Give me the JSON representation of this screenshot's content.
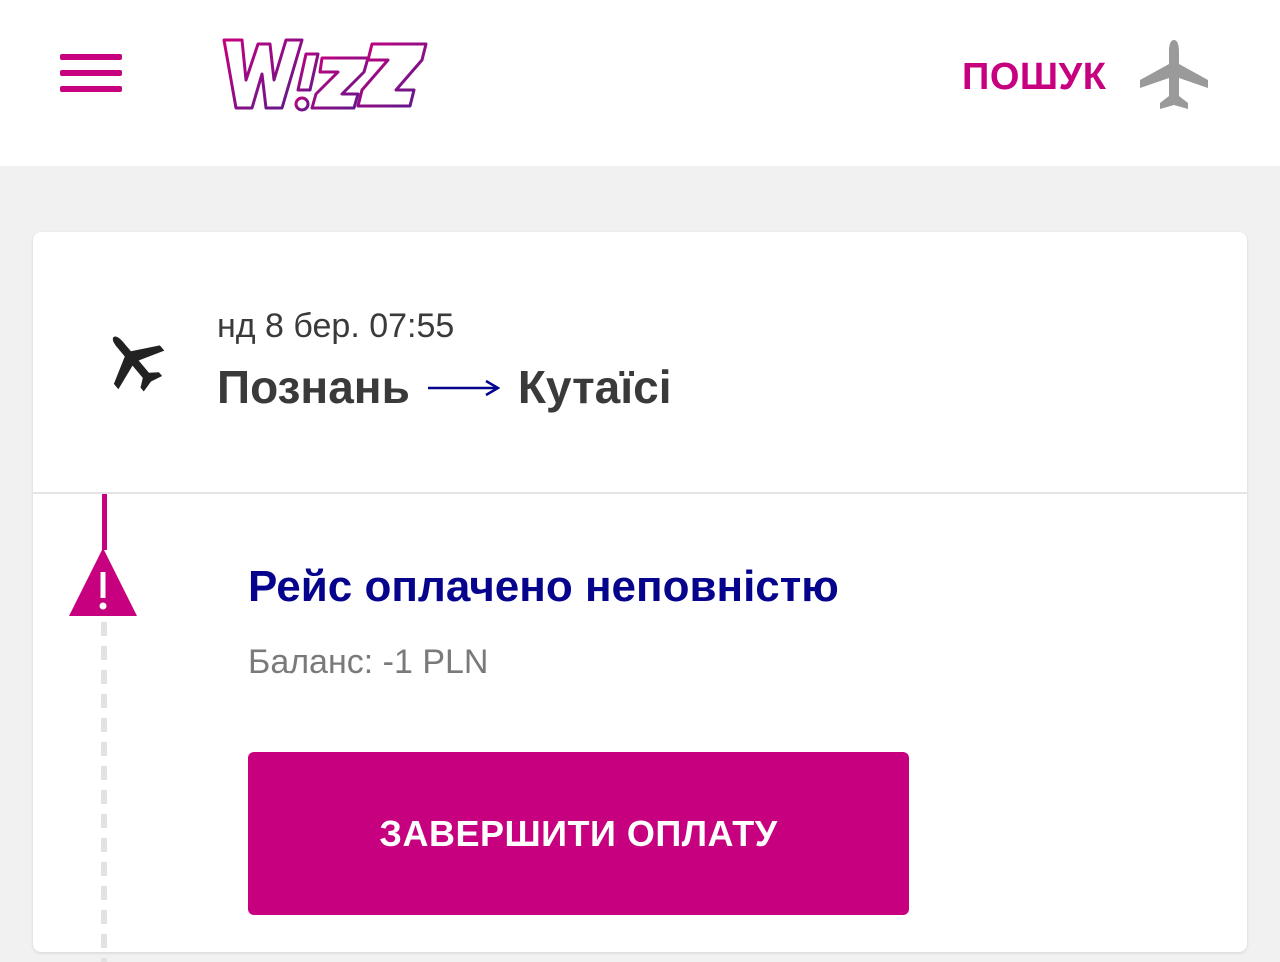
{
  "header": {
    "logo_text": "WIZZ",
    "search_label": "ПОШУК",
    "icons": {
      "menu": "hamburger-menu-icon",
      "search": "airplane-icon"
    }
  },
  "flight": {
    "date_time": "нд 8 бер. 07:55",
    "origin": "Познань",
    "destination": "Кутаїсі",
    "icons": {
      "flight": "airplane-icon",
      "route": "arrow-right-icon"
    }
  },
  "status": {
    "title": "Рейс оплачено неповністю",
    "balance": "Баланс: -1 PLN",
    "icon": "warning-icon"
  },
  "actions": {
    "complete_payment_label": "ЗАВЕРШИТИ ОПЛАТУ"
  },
  "colors": {
    "brand_magenta": "#c6007e",
    "brand_navy": "#06038d",
    "background": "#f1f1f1",
    "card": "#ffffff"
  }
}
